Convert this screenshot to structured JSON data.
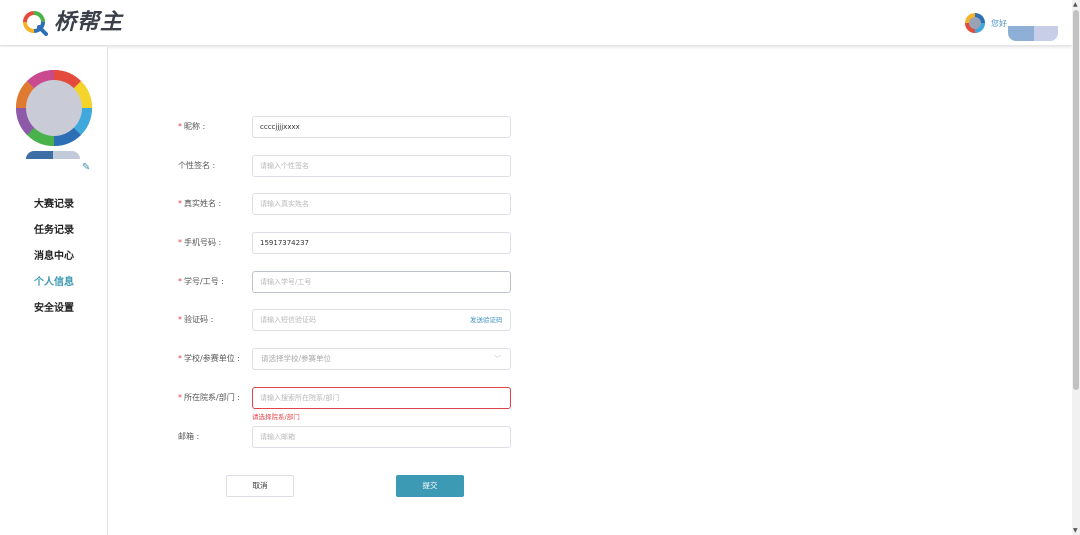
{
  "header": {
    "brand": "桥帮主",
    "greeting": "您好"
  },
  "sidebar": {
    "menu": [
      {
        "label": "大赛记录"
      },
      {
        "label": "任务记录"
      },
      {
        "label": "消息中心"
      },
      {
        "label": "个人信息"
      },
      {
        "label": "安全设置"
      }
    ],
    "active_index": 3,
    "edit_icon": "✎"
  },
  "form": {
    "nickname": {
      "label": "昵称 :",
      "required": "*",
      "value": "ccccjjjjxxxx"
    },
    "signature": {
      "label": "个性签名 :",
      "placeholder": "请输入个性签名"
    },
    "real_name": {
      "label": "真实姓名 :",
      "required": "*",
      "placeholder": "请输入真实姓名"
    },
    "phone": {
      "label": "手机号码 :",
      "required": "*",
      "value": "15917374237"
    },
    "student_id": {
      "label": "学号/工号 :",
      "required": "*",
      "placeholder": "请输入学号/工号"
    },
    "code": {
      "label": "验证码 :",
      "required": "*",
      "placeholder": "请输入短信验证码",
      "send_label": "发送验证码"
    },
    "school": {
      "label": "学校/参赛单位 :",
      "required": "*",
      "placeholder": "请选择学校/参赛单位"
    },
    "department": {
      "label": "所在院系/部门 :",
      "required": "*",
      "placeholder": "请输入搜索所在院系/部门",
      "error": "请选择院系/部门"
    },
    "email": {
      "label": "邮箱 :",
      "placeholder": "请输入邮箱"
    },
    "cancel_label": "取消",
    "submit_label": "提交"
  },
  "colors": {
    "accent": "#3c9ab4",
    "error": "#e0434b",
    "link": "#3f8fc0"
  }
}
